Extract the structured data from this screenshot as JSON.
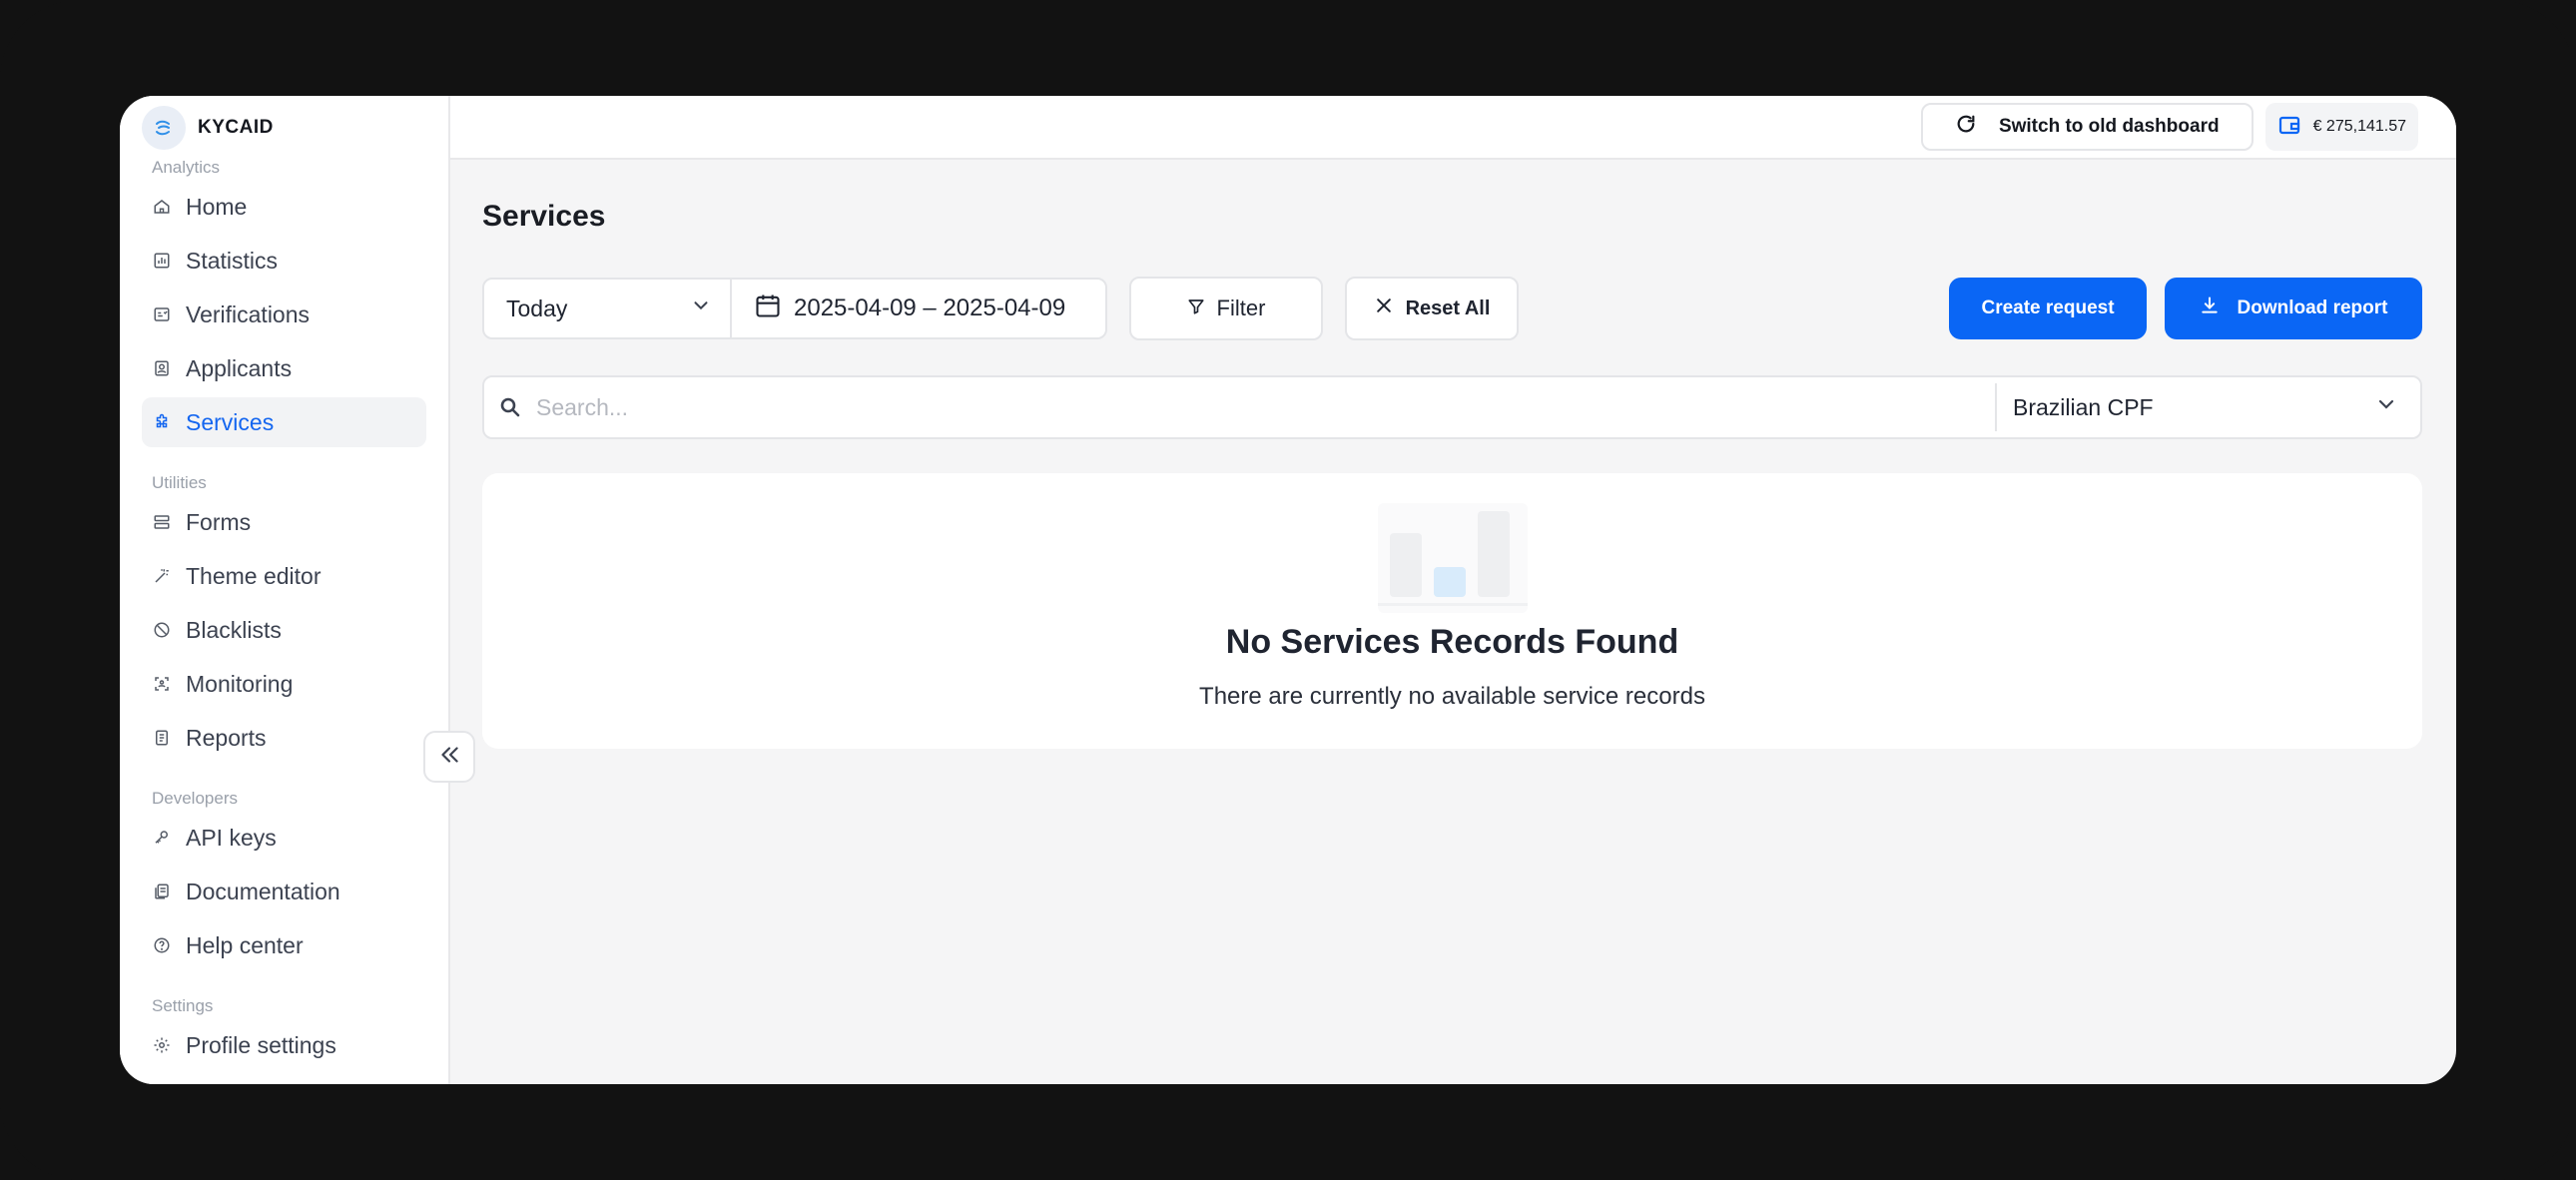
{
  "brand": {
    "name": "KYCAID"
  },
  "sidebar": {
    "sections": [
      {
        "label": "Analytics",
        "items": [
          {
            "label": "Home",
            "icon": "home-icon"
          },
          {
            "label": "Statistics",
            "icon": "chart-icon"
          },
          {
            "label": "Verifications",
            "icon": "id-card-icon"
          },
          {
            "label": "Applicants",
            "icon": "user-badge-icon"
          },
          {
            "label": "Services",
            "icon": "puzzle-icon",
            "active": true
          }
        ]
      },
      {
        "label": "Utilities",
        "items": [
          {
            "label": "Forms",
            "icon": "form-icon"
          },
          {
            "label": "Theme editor",
            "icon": "magic-wand-icon"
          },
          {
            "label": "Blacklists",
            "icon": "ban-icon"
          },
          {
            "label": "Monitoring",
            "icon": "scan-icon"
          },
          {
            "label": "Reports",
            "icon": "report-icon"
          }
        ]
      },
      {
        "label": "Developers",
        "items": [
          {
            "label": "API keys",
            "icon": "key-icon"
          },
          {
            "label": "Documentation",
            "icon": "docs-icon"
          },
          {
            "label": "Help center",
            "icon": "help-icon"
          }
        ]
      },
      {
        "label": "Settings",
        "items": [
          {
            "label": "Profile settings",
            "icon": "gear-icon"
          }
        ]
      }
    ]
  },
  "topbar": {
    "switch_label": "Switch to old dashboard",
    "balance": "€ 275,141.57"
  },
  "page": {
    "title": "Services"
  },
  "toolbar": {
    "range_value": "Today",
    "date_range": "2025-04-09 – 2025-04-09",
    "filter_label": "Filter",
    "reset_label": "Reset All",
    "create_label": "Create request",
    "download_label": "Download report"
  },
  "search": {
    "placeholder": "Search...",
    "value": "",
    "doc_type": "Brazilian CPF"
  },
  "empty_state": {
    "title": "No Services Records Found",
    "subtitle": "There are currently no available service records"
  },
  "colors": {
    "accent": "#0a66f5",
    "active_text": "#1466f0"
  }
}
